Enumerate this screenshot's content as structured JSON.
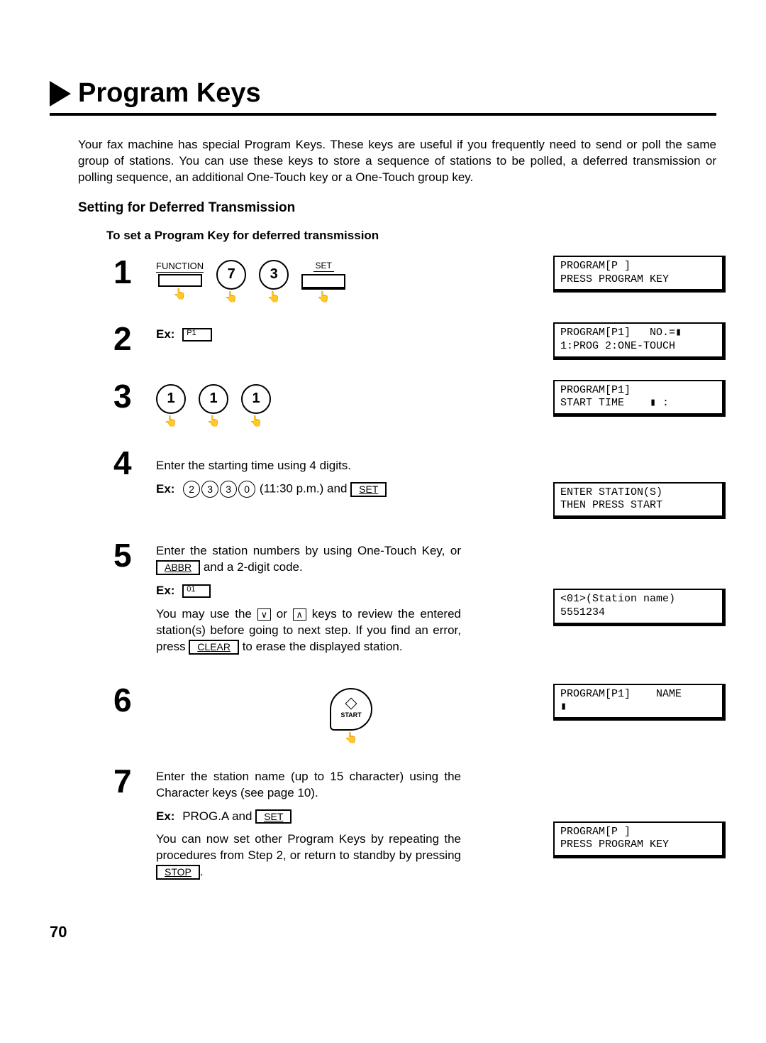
{
  "title": "Program Keys",
  "intro": "Your fax machine has special Program Keys. These keys are useful if you frequently need to send or poll the same group of stations. You can use these keys to store a sequence of stations to be polled, a deferred transmission or polling sequence, an additional One-Touch key or a One-Touch group key.",
  "section_head": "Setting for Deferred Transmission",
  "sub_head": "To set a Program Key for deferred transmission",
  "steps": {
    "s1": {
      "num": "1",
      "func_label": "FUNCTION",
      "k1": "7",
      "k2": "3",
      "set_label": "SET",
      "display": "PROGRAM[P ]\nPRESS PROGRAM KEY"
    },
    "s2": {
      "num": "2",
      "ex": "Ex:",
      "box": "P1",
      "display": "PROGRAM[P1]   NO.=▮\n1:PROG 2:ONE-TOUCH"
    },
    "s3": {
      "num": "3",
      "k1": "1",
      "k2": "1",
      "k3": "1",
      "display": "PROGRAM[P1]\nSTART TIME    ▮ :"
    },
    "s4": {
      "num": "4",
      "text1": "Enter the starting time using 4 digits.",
      "ex": "Ex:",
      "d1": "2",
      "d2": "3",
      "d3": "3",
      "d4": "0",
      "time_note": " (11:30 p.m.) and ",
      "set": "SET",
      "display": "ENTER STATION(S)\nTHEN PRESS START"
    },
    "s5": {
      "num": "5",
      "text1a": "Enter the station numbers by using One-Touch Key, or ",
      "abbr": "ABBR",
      "text1b": " and a 2-digit code.",
      "ex": "Ex:",
      "box": "01",
      "text2a": "You may use the ",
      "down": "∨",
      "text2b": " or ",
      "up": "∧",
      "text2c": " keys to review the entered station(s) before going to next step. If you find an error, press ",
      "clear": "CLEAR",
      "text2d": " to erase the displayed station.",
      "display": "<01>(Station name)\n5551234"
    },
    "s6": {
      "num": "6",
      "start": "START",
      "display": "PROGRAM[P1]    NAME\n▮"
    },
    "s7": {
      "num": "7",
      "text1": "Enter the station name (up to 15 character) using the Character keys (see page 10).",
      "ex": "Ex:",
      "ex_val": " PROG.A and ",
      "set": "SET",
      "text2a": "You can now set other Program Keys by repeating the procedures from Step 2, or return to standby by pressing ",
      "stop": "STOP",
      "text2b": ".",
      "display": "PROGRAM[P ]\nPRESS PROGRAM KEY"
    }
  },
  "page_number": "70"
}
